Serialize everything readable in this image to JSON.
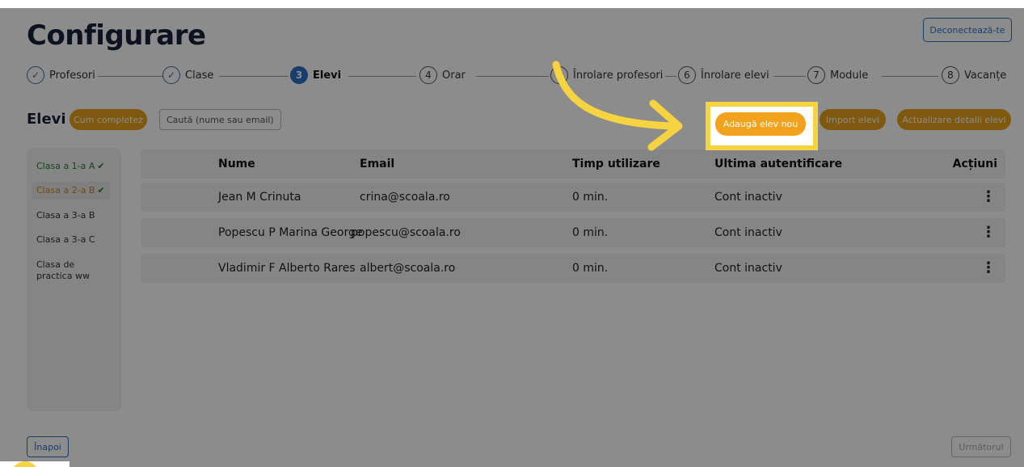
{
  "header": {
    "title": "Configurare",
    "logout_label": "Deconectează-te"
  },
  "stepper": {
    "steps": [
      {
        "marker": "✓",
        "label": "Profesori"
      },
      {
        "marker": "✓",
        "label": "Clase"
      },
      {
        "marker": "3",
        "label": "Elevi"
      },
      {
        "marker": "4",
        "label": "Orar"
      },
      {
        "marker": "",
        "label": "Înrolare profesori"
      },
      {
        "marker": "6",
        "label": "Înrolare elevi"
      },
      {
        "marker": "7",
        "label": "Module"
      },
      {
        "marker": "8",
        "label": "Vacanțe"
      }
    ]
  },
  "toolbar": {
    "section_title": "Elevi",
    "help_label": "Cum completez",
    "search_placeholder": "Caută (nume sau email)",
    "add_label": "Adaugă elev nou",
    "import_label": "Import elevi",
    "update_label": "Actualizare detalii elevi"
  },
  "sidebar": {
    "classes": [
      {
        "label": "Clasa a 1-a A",
        "check": "✔"
      },
      {
        "label": "Clasa a 2-a B",
        "check": "✔"
      },
      {
        "label": "Clasa a 3-a B",
        "check": ""
      },
      {
        "label": "Clasa a 3-a C",
        "check": ""
      },
      {
        "label": "Clasa de practica ww",
        "check": ""
      }
    ]
  },
  "table": {
    "headers": {
      "name": "Nume",
      "email": "Email",
      "time": "Timp utilizare",
      "last_login": "Ultima autentificare",
      "actions": "Acțiuni"
    },
    "rows": [
      {
        "name": "Jean M Crinuta",
        "email": "crina@scoala.ro",
        "time": "0 min.",
        "last_login": "Cont inactiv",
        "actions": "⋮"
      },
      {
        "name": "Popescu P Marina George",
        "email": "popescu@scoala.ro",
        "time": "0 min.",
        "last_login": "Cont inactiv",
        "actions": "⋮"
      },
      {
        "name": "Vladimir F Alberto Rares",
        "email": "albert@scoala.ro",
        "time": "0 min.",
        "last_login": "Cont inactiv",
        "actions": "⋮"
      }
    ]
  },
  "footer": {
    "back_label": "Înapoi",
    "next_label": "Următorul"
  },
  "colors": {
    "accent": "#f2a21c",
    "primary": "#2f6fc4",
    "highlight": "#f6d340",
    "success": "#2e7d2e"
  }
}
